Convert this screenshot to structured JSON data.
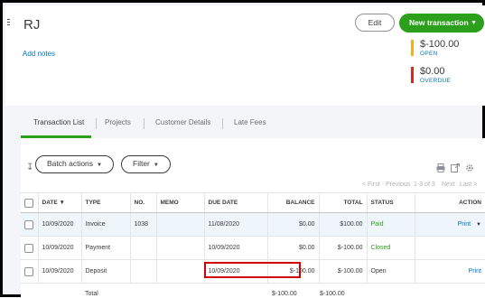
{
  "header": {
    "customer_name": "RJ",
    "add_notes_link": "Add notes",
    "edit_button": "Edit",
    "new_transaction_button": "New transaction",
    "open_amount": "$-100.00",
    "open_label": "OPEN",
    "overdue_amount": "$0.00",
    "overdue_label": "OVERDUE",
    "colors": {
      "accent_green": "#2ca01c",
      "open_bar": "#f2b01e",
      "overdue_bar": "#d52b1e",
      "link_blue": "#0077c5"
    }
  },
  "tabs": [
    {
      "label": "Transaction List",
      "active": true
    },
    {
      "label": "Projects"
    },
    {
      "label": "Customer Details"
    },
    {
      "label": "Late Fees"
    }
  ],
  "toolbar": {
    "batch_actions": "Batch actions",
    "filter": "Filter",
    "icons": [
      "sort-icon",
      "print-icon",
      "export-icon",
      "settings-icon"
    ]
  },
  "pager": {
    "first": "< First",
    "previous": "Previous",
    "count": "1-3 of 3",
    "next": "Next",
    "last": "Last >"
  },
  "table": {
    "columns": [
      "DATE ▼",
      "TYPE",
      "NO.",
      "MEMO",
      "DUE DATE",
      "BALANCE",
      "TOTAL",
      "STATUS",
      "ACTION"
    ],
    "rows": [
      {
        "date": "10/09/2020",
        "type": "Invoice",
        "no": "1038",
        "memo": "",
        "due_date": "11/08/2020",
        "balance": "$0.00",
        "total": "$100.00",
        "status": "Paid",
        "action": "Print"
      },
      {
        "date": "10/09/2020",
        "type": "Payment",
        "no": "",
        "memo": "",
        "due_date": "10/09/2020",
        "balance": "$0.00",
        "total": "$-100.00",
        "status": "Closed",
        "action": ""
      },
      {
        "date": "10/09/2020",
        "type": "Deposit",
        "no": "",
        "memo": "",
        "due_date": "10/09/2020",
        "balance": "$-100.00",
        "total": "$-100.00",
        "status": "Open",
        "action": "Print"
      }
    ],
    "total_row": {
      "label": "Total",
      "balance": "$-100.00",
      "total": "$-100.00"
    }
  }
}
